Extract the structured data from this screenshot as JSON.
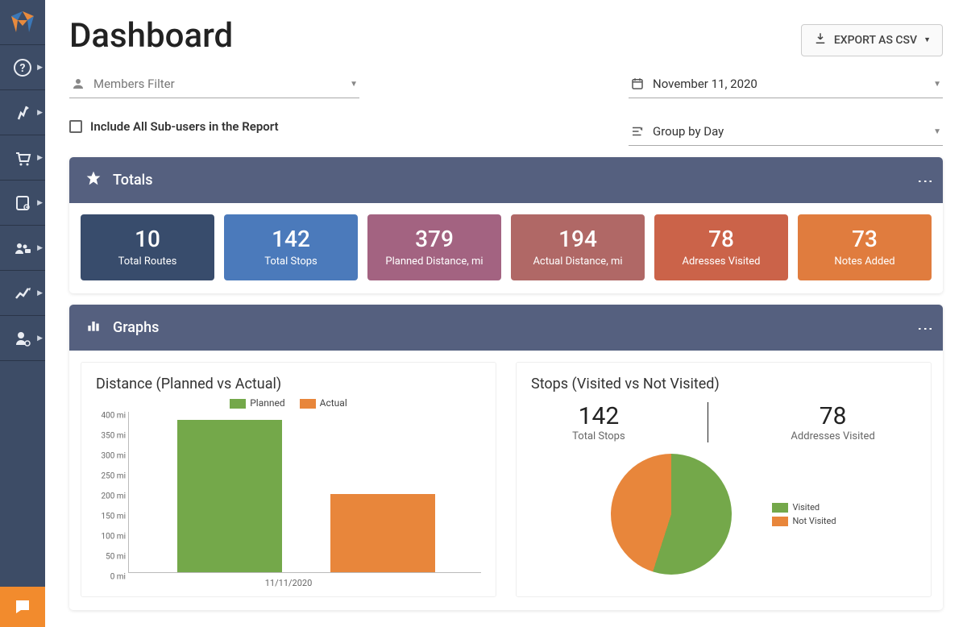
{
  "header": {
    "title": "Dashboard",
    "export_label": "EXPORT AS CSV"
  },
  "filters": {
    "members_placeholder": "Members Filter",
    "include_sub_label": "Include All Sub-users in the Report",
    "date_value": "November 11, 2020",
    "group_value": "Group by Day"
  },
  "totals_panel": {
    "title": "Totals",
    "tiles": [
      {
        "value": "10",
        "label": "Total Routes"
      },
      {
        "value": "142",
        "label": "Total Stops"
      },
      {
        "value": "379",
        "label": "Planned Distance, mi"
      },
      {
        "value": "194",
        "label": "Actual Distance, mi"
      },
      {
        "value": "78",
        "label": "Adresses Visited"
      },
      {
        "value": "73",
        "label": "Notes Added"
      }
    ]
  },
  "graphs_panel": {
    "title": "Graphs",
    "bar": {
      "title": "Distance (Planned vs Actual)",
      "legend_planned": "Planned",
      "legend_actual": "Actual",
      "xcategory": "11/11/2020"
    },
    "pie": {
      "title": "Stops (Visited vs Not Visited)",
      "total_stops_value": "142",
      "total_stops_label": "Total Stops",
      "visited_value": "78",
      "visited_label": "Addresses Visited",
      "legend_visited": "Visited",
      "legend_not": "Not Visited"
    }
  },
  "chart_data": [
    {
      "type": "bar",
      "title": "Distance (Planned vs Actual)",
      "categories": [
        "11/11/2020"
      ],
      "series": [
        {
          "name": "Planned",
          "values": [
            379
          ],
          "color": "#74a84a"
        },
        {
          "name": "Actual",
          "values": [
            194
          ],
          "color": "#e8863b"
        }
      ],
      "ylabel": "mi",
      "ylim": [
        0,
        400
      ],
      "yticks": [
        0,
        50,
        100,
        150,
        200,
        250,
        300,
        350,
        400
      ]
    },
    {
      "type": "pie",
      "title": "Stops (Visited vs Not Visited)",
      "series": [
        {
          "name": "Visited",
          "value": 78,
          "color": "#74a84a"
        },
        {
          "name": "Not Visited",
          "value": 64,
          "color": "#e8863b"
        }
      ],
      "total": 142
    }
  ],
  "colors": {
    "green": "#74a84a",
    "orange": "#e8863b"
  }
}
